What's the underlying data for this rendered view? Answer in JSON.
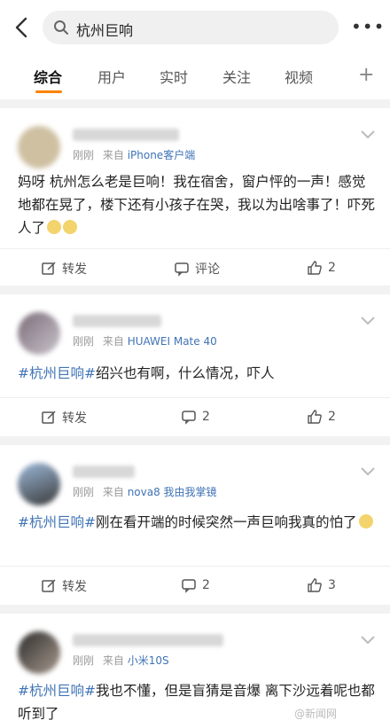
{
  "search": {
    "query": "杭州巨响"
  },
  "tabs": [
    "综合",
    "用户",
    "实时",
    "关注",
    "视频"
  ],
  "posts": [
    {
      "time": "刚刚",
      "from_label": "来自",
      "source": "iPhone客户端",
      "text": "妈呀 杭州怎么老是巨响！我在宿舍，窗户怦的一声！感觉地都在晃了，楼下还有小孩子在哭，我以为出啥事了！吓死人了",
      "hashtag": "",
      "repost": "转发",
      "comment": "评论",
      "likes": "2"
    },
    {
      "time": "刚刚",
      "from_label": "来自",
      "source": "HUAWEI Mate 40",
      "hashtag": "#杭州巨响#",
      "text": "绍兴也有啊，什么情况，吓人",
      "repost": "转发",
      "comment": "2",
      "likes": "2"
    },
    {
      "time": "刚刚",
      "from_label": "来自",
      "source": "nova8 我由我掌镜",
      "hashtag": "#杭州巨响#",
      "text": "刚在看开端的时候突然一声巨响我真的怕了",
      "repost": "转发",
      "comment": "2",
      "likes": "3"
    },
    {
      "time": "刚刚",
      "from_label": "来自",
      "source": "小米10S",
      "hashtag": "#杭州巨响#",
      "text": "我也不懂，但是盲猜是音爆 离下沙远着呢也都听到了",
      "repost": "",
      "comment": "",
      "likes": ""
    }
  ],
  "watermark": "@新闻网",
  "colors": {
    "accent": "#ff8200",
    "link": "#3f73b6"
  }
}
